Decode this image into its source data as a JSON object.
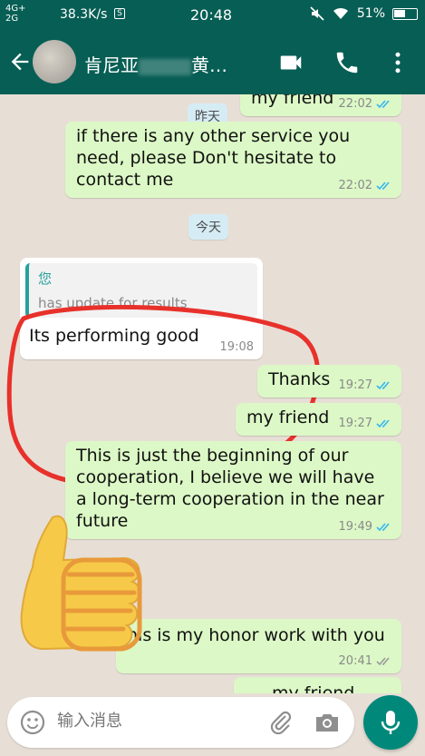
{
  "status_bar": {
    "network_top": "4G+",
    "network_bottom": "2G",
    "speed": "38.3K/s",
    "s_icon": "S",
    "time": "20:48",
    "battery": "51%"
  },
  "app_bar": {
    "contact_name_start": "肯尼亚",
    "contact_name_end": "黄…",
    "icons": [
      "back-arrow-icon",
      "video-call-icon",
      "phone-icon",
      "more-options-icon"
    ]
  },
  "messages": [
    {
      "text": "my friend",
      "time": "22:02"
    },
    {
      "date": "昨天"
    },
    {
      "lines": [
        "if there is any other service you",
        "need, please Don't hesitate to",
        "contact me"
      ],
      "time": "22:02"
    },
    {
      "date": "今天"
    },
    {
      "quote_author": "您",
      "quote_text": "has update for results",
      "text": "Its performing good",
      "time": "19:08"
    },
    {
      "text": "Thanks",
      "time": "19:27"
    },
    {
      "text": "my friend",
      "time": "19:27"
    },
    {
      "lines": [
        "This is just the beginning of our",
        "cooperation, I believe we will have",
        "a long-term cooperation in the near",
        "future"
      ],
      "time": "19:49"
    },
    {
      "text": "his is my honor work with you",
      "time": "20:41"
    },
    {
      "text": "my friend"
    }
  ],
  "input": {
    "placeholder": "输入消息"
  },
  "colors": {
    "header": "#075e54",
    "outgoing_bubble": "#dcf8c6",
    "incoming_bubble": "#ffffff",
    "read_tick": "#34b7f1",
    "annotation_circle": "#e8312b",
    "mic_button": "#00897b"
  }
}
